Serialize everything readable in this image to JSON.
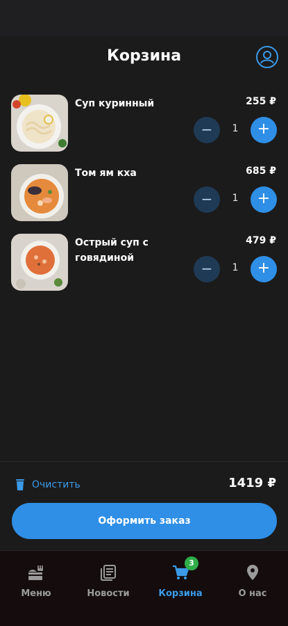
{
  "header": {
    "title": "Корзина"
  },
  "items": [
    {
      "name": "Суп куринный",
      "price": "255 ₽",
      "quantity": "1",
      "minus": "−",
      "plus": "+"
    },
    {
      "name": "Том ям кха",
      "price": "685 ₽",
      "quantity": "1",
      "minus": "−",
      "plus": "+"
    },
    {
      "name": "Острый суп с говядиной",
      "price": "479 ₽",
      "quantity": "1",
      "minus": "−",
      "plus": "+"
    }
  ],
  "summary": {
    "clear_label": "Очистить",
    "total": "1419 ₽",
    "checkout_label": "Оформить заказ"
  },
  "nav": {
    "items": [
      {
        "label": "Меню",
        "icon": "menu-food-icon"
      },
      {
        "label": "Новости",
        "icon": "news-icon"
      },
      {
        "label": "Корзина",
        "icon": "cart-icon",
        "badge": "3",
        "active": true
      },
      {
        "label": "О нас",
        "icon": "location-pin-icon"
      }
    ]
  },
  "colors": {
    "accent": "#2f8fe6",
    "badge": "#2fae4a",
    "background": "#1b1b1c"
  }
}
